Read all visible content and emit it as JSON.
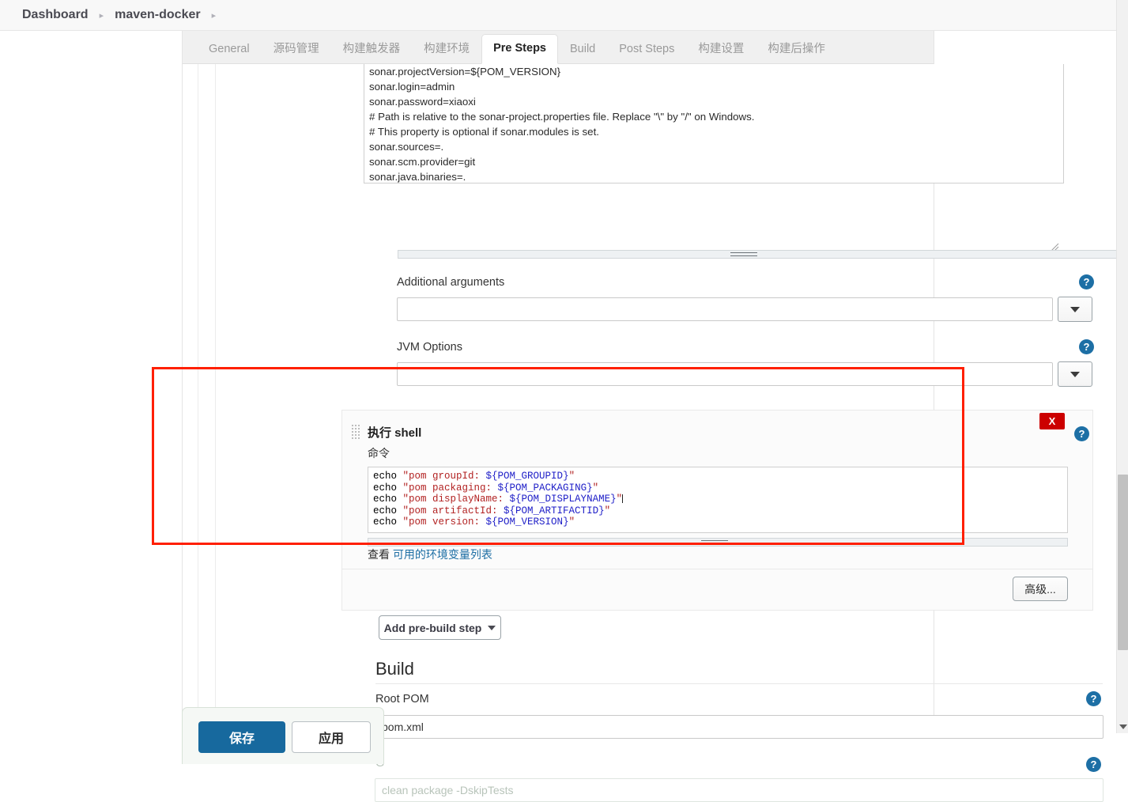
{
  "breadcrumb": {
    "items": [
      {
        "label": "Dashboard"
      },
      {
        "label": "maven-docker"
      }
    ],
    "separator": "▸"
  },
  "tabs": [
    {
      "label": "General",
      "active": false
    },
    {
      "label": "源码管理",
      "active": false
    },
    {
      "label": "构建触发器",
      "active": false
    },
    {
      "label": "构建环境",
      "active": false
    },
    {
      "label": "Pre Steps",
      "active": true
    },
    {
      "label": "Build",
      "active": false
    },
    {
      "label": "Post Steps",
      "active": false
    },
    {
      "label": "构建设置",
      "active": false
    },
    {
      "label": "构建后操作",
      "active": false
    }
  ],
  "sonar_properties": {
    "value": "sonar.projectVersion=${POM_VERSION}\nsonar.login=admin\nsonar.password=xiaoxi\n# Path is relative to the sonar-project.properties file. Replace \"\\\" by \"/\" on Windows.\n# This property is optional if sonar.modules is set.\nsonar.sources=.\nsonar.scm.provider=git\nsonar.java.binaries=."
  },
  "fields": {
    "additional_arguments": {
      "label": "Additional arguments",
      "value": "",
      "help": "?"
    },
    "jvm_options": {
      "label": "JVM Options",
      "value": "",
      "help": "?"
    }
  },
  "shell_step": {
    "title": "执行 shell",
    "command_label": "命令",
    "delete_label": "X",
    "help": "?",
    "command_lines": [
      {
        "cmd": "echo ",
        "str_open": "\"",
        "text": "pom groupId: ",
        "var": "${POM_GROUPID}",
        "str_close": "\"",
        "cursor": false
      },
      {
        "cmd": "echo ",
        "str_open": "\"",
        "text": "pom packaging: ",
        "var": "${POM_PACKAGING}",
        "str_close": "\"",
        "cursor": false
      },
      {
        "cmd": "echo ",
        "str_open": "\"",
        "text": "pom displayName: ",
        "var": "${POM_DISPLAYNAME}",
        "str_close": "\"",
        "cursor": true
      },
      {
        "cmd": "echo ",
        "str_open": "\"",
        "text": "pom artifactId: ",
        "var": "${POM_ARTIFACTID}",
        "str_close": "\"",
        "cursor": false
      },
      {
        "cmd": "echo ",
        "str_open": "\"",
        "text": "pom version: ",
        "var": "${POM_VERSION}",
        "str_close": "\"",
        "cursor": false
      }
    ],
    "env_hint_lead": "查看",
    "env_hint_link": "可用的环境变量列表"
  },
  "buttons": {
    "advanced": "高级...",
    "add_pre_build_step": "Add pre-build step",
    "save": "保存",
    "apply": "应用"
  },
  "build_section": {
    "heading": "Build",
    "root_pom_label": "Root POM",
    "root_pom_value": "pom.xml",
    "goals_label_partial": "G",
    "goals_value_partial": "clean package -DskipTests",
    "help": "?"
  },
  "colors": {
    "accent_blue": "#17699e",
    "help_blue": "#1d6fa5",
    "delete_red": "#cc0000",
    "annotation_red": "#ff1f00",
    "string_token": "#b22222",
    "var_token": "#2020c8"
  },
  "icons": {
    "drag_handle": "drag-handle-icon",
    "help": "help-icon",
    "chevron_down": "chevron-down-icon",
    "breadcrumb_chevron": "chevron-right-icon"
  }
}
